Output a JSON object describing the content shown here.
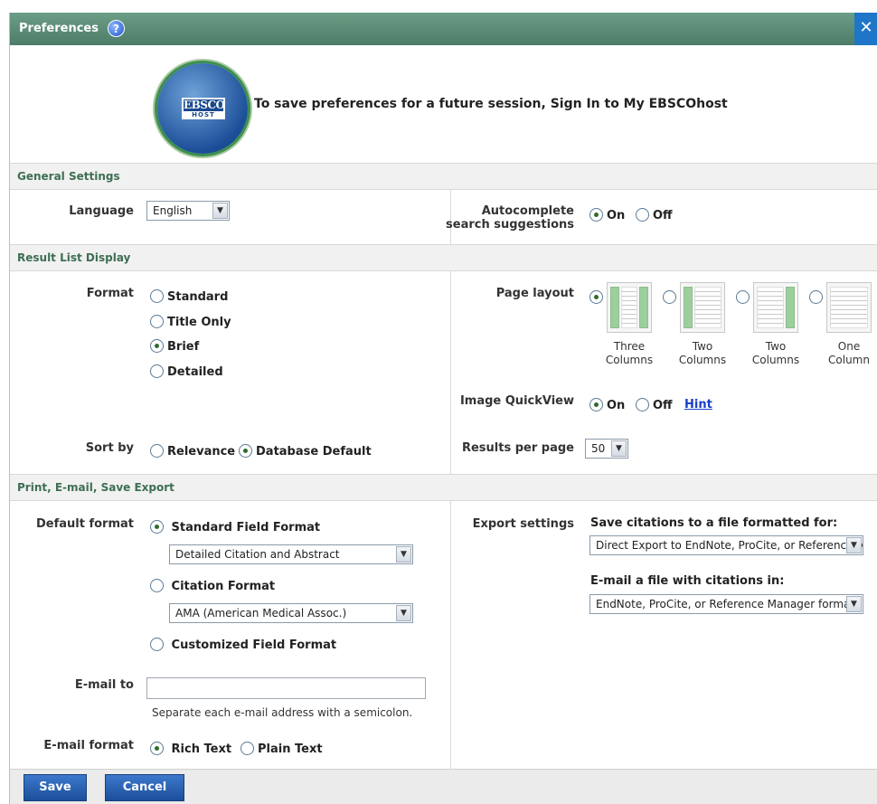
{
  "window": {
    "title": "Preferences",
    "help_icon": "?",
    "close_glyph": "✕"
  },
  "banner": {
    "logo_line1": "EBSCO",
    "logo_line2": "HOST",
    "text": "To save preferences for a future session, Sign In to My EBSCOhost"
  },
  "general": {
    "header": "General Settings",
    "language_label": "Language",
    "language_value": "English",
    "autocomplete_label_1": "Autocomplete",
    "autocomplete_label_2": "search suggestions",
    "on_label": "On",
    "off_label": "Off",
    "autocomplete_selected": "On"
  },
  "results": {
    "header": "Result List Display",
    "format_label": "Format",
    "formats": [
      "Standard",
      "Title Only",
      "Brief",
      "Detailed"
    ],
    "format_selected": "Brief",
    "page_layout_label": "Page layout",
    "layouts": [
      {
        "caption_1": "Three",
        "caption_2": "Columns",
        "selected": true
      },
      {
        "caption_1": "Two",
        "caption_2": "Columns",
        "selected": false
      },
      {
        "caption_1": "Two",
        "caption_2": "Columns",
        "selected": false
      },
      {
        "caption_1": "One",
        "caption_2": "Column",
        "selected": false
      }
    ],
    "image_quickview_label": "Image QuickView",
    "quickview_on": "On",
    "quickview_off": "Off",
    "quickview_selected": "On",
    "hint_link": "Hint",
    "sort_label": "Sort by",
    "sort_relevance": "Relevance",
    "sort_database": "Database Default",
    "sort_selected": "Database Default",
    "per_page_label": "Results per page",
    "per_page_value": "50"
  },
  "export": {
    "header": "Print, E-mail, Save Export",
    "default_format_label": "Default format",
    "standard_field_format": "Standard Field Format",
    "standard_select": "Detailed Citation and Abstract",
    "citation_format": "Citation Format",
    "citation_select": "AMA (American Medical Assoc.)",
    "customized_field_format": "Customized Field Format",
    "format_selected": "Standard Field Format",
    "email_to_label": "E-mail to",
    "email_to_value": "",
    "email_hint": "Separate each e-mail address with a semicolon.",
    "email_format_label": "E-mail format",
    "rich_text": "Rich Text",
    "plain_text": "Plain Text",
    "email_format_selected": "Rich Text",
    "export_settings_label": "Export settings",
    "save_citations_label": "Save citations to a file formatted for:",
    "save_citations_select": "Direct Export to EndNote, ProCite, or Reference Manager",
    "email_citations_label": "E-mail a file with citations in:",
    "email_citations_select": "EndNote, ProCite, or Reference Manager format"
  },
  "footer": {
    "save": "Save",
    "cancel": "Cancel"
  },
  "colors": {
    "title_bar": "#5a8a74",
    "section_text": "#3d6e53",
    "button": "#2a62b3",
    "close": "#1f76c9",
    "link": "#1a3fc7"
  }
}
